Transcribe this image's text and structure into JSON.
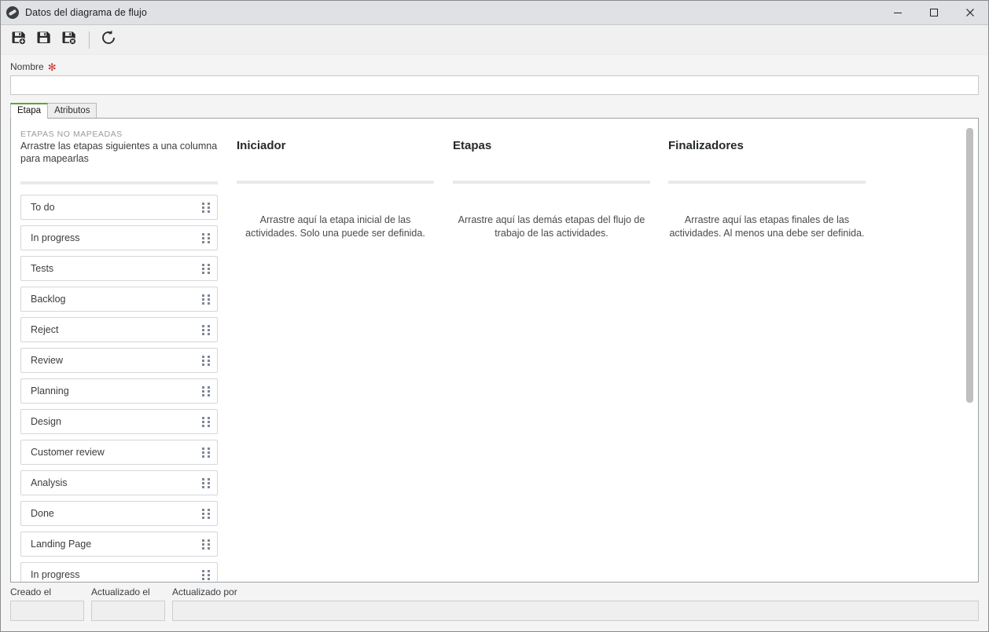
{
  "window": {
    "title": "Datos del diagrama de flujo",
    "app_icon": "globe-icon",
    "minimize_label": "Minimizar",
    "maximize_label": "Maximizar",
    "close_label": "Cerrar"
  },
  "toolbar": {
    "buttons": [
      {
        "name": "save-and-new-button",
        "icon": "floppy-disk-add-icon",
        "tooltip": "Guardar y nuevo"
      },
      {
        "name": "save-button",
        "icon": "floppy-disk-icon",
        "tooltip": "Guardar"
      },
      {
        "name": "save-and-close-button",
        "icon": "floppy-disk-close-icon",
        "tooltip": "Guardar y cerrar"
      },
      {
        "name": "refresh-button",
        "icon": "refresh-icon",
        "tooltip": "Actualizar"
      }
    ]
  },
  "form": {
    "name_label": "Nombre",
    "name_required_icon": "required-asterisk-icon",
    "name_value": "",
    "name_placeholder": ""
  },
  "tabs": [
    {
      "label": "Etapa",
      "active": true
    },
    {
      "label": "Atributos",
      "active": false
    }
  ],
  "board": {
    "unmapped": {
      "kicker": "ETAPAS NO MAPEADAS",
      "subtitle": "Arrastre las etapas siguientes a una columna para mapearlas",
      "cards": [
        {
          "label": "To do"
        },
        {
          "label": "In progress"
        },
        {
          "label": "Tests"
        },
        {
          "label": "Backlog"
        },
        {
          "label": "Reject"
        },
        {
          "label": "Review"
        },
        {
          "label": "Planning"
        },
        {
          "label": "Design"
        },
        {
          "label": "Customer review"
        },
        {
          "label": "Analysis"
        },
        {
          "label": "Done"
        },
        {
          "label": "Landing Page"
        },
        {
          "label": "In progress"
        }
      ]
    },
    "columns": [
      {
        "title": "Iniciador",
        "hint": "Arrastre aquí la etapa inicial de las actividades. Solo una puede ser definida."
      },
      {
        "title": "Etapas",
        "hint": "Arrastre aquí las demás etapas del flujo de trabajo de las actividades."
      },
      {
        "title": "Finalizadores",
        "hint": "Arrastre aquí las etapas finales de las actividades. Al menos una debe ser definida."
      }
    ]
  },
  "footer": {
    "created_label": "Creado el",
    "created_value": "",
    "updated_label": "Actualizado el",
    "updated_value": "",
    "updated_by_label": "Actualizado por",
    "updated_by_value": ""
  },
  "colors": {
    "active_tab_accent": "#5ca732",
    "required_marker": "#d03030",
    "titlebar": "#dfe1e5",
    "panel_border": "#9aa3a8"
  }
}
